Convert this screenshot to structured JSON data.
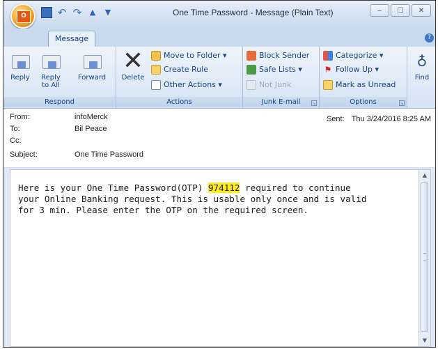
{
  "window": {
    "title": "One Time Password - Message (Plain Text)",
    "min": "‒",
    "max": "☐",
    "close": "✕"
  },
  "tabs": {
    "message": "Message",
    "help": "?"
  },
  "ribbon": {
    "respond": {
      "label": "Respond",
      "reply": "Reply",
      "reply_all_1": "Reply",
      "reply_all_2": "to All",
      "forward": "Forward"
    },
    "actions": {
      "label": "Actions",
      "delete": "Delete",
      "move_to_folder": "Move to Folder ▾",
      "create_rule": "Create Rule",
      "other_actions": "Other Actions ▾"
    },
    "junk": {
      "label": "Junk E-mail",
      "block_sender": "Block Sender",
      "safe_lists": "Safe Lists ▾",
      "not_junk": "Not Junk"
    },
    "options": {
      "label": "Options",
      "categorize": "Categorize ▾",
      "follow_up": "Follow Up ▾",
      "mark_unread": "Mark as Unread"
    },
    "find": {
      "label": "Find"
    }
  },
  "header": {
    "from_label": "From:",
    "from_value": "infoMerck",
    "to_label": "To:",
    "to_value": "Bil Peace",
    "cc_label": "Cc:",
    "cc_value": "",
    "subject_label": "Subject:",
    "subject_value": "One Time Password",
    "sent_label": "Sent:",
    "sent_value": "Thu 3/24/2016 8:25 AM"
  },
  "body": {
    "line1_pre": "Here is your One Time Password(OTP) ",
    "otp": "974112",
    "line1_post": " required to continue",
    "line2": "your Online Banking request. This is usable only once and is valid",
    "line3": "for 3 min. Please enter the OTP on the required screen."
  },
  "colors": {
    "highlight": "#ffec1a",
    "ribbon_text": "#15428b"
  }
}
